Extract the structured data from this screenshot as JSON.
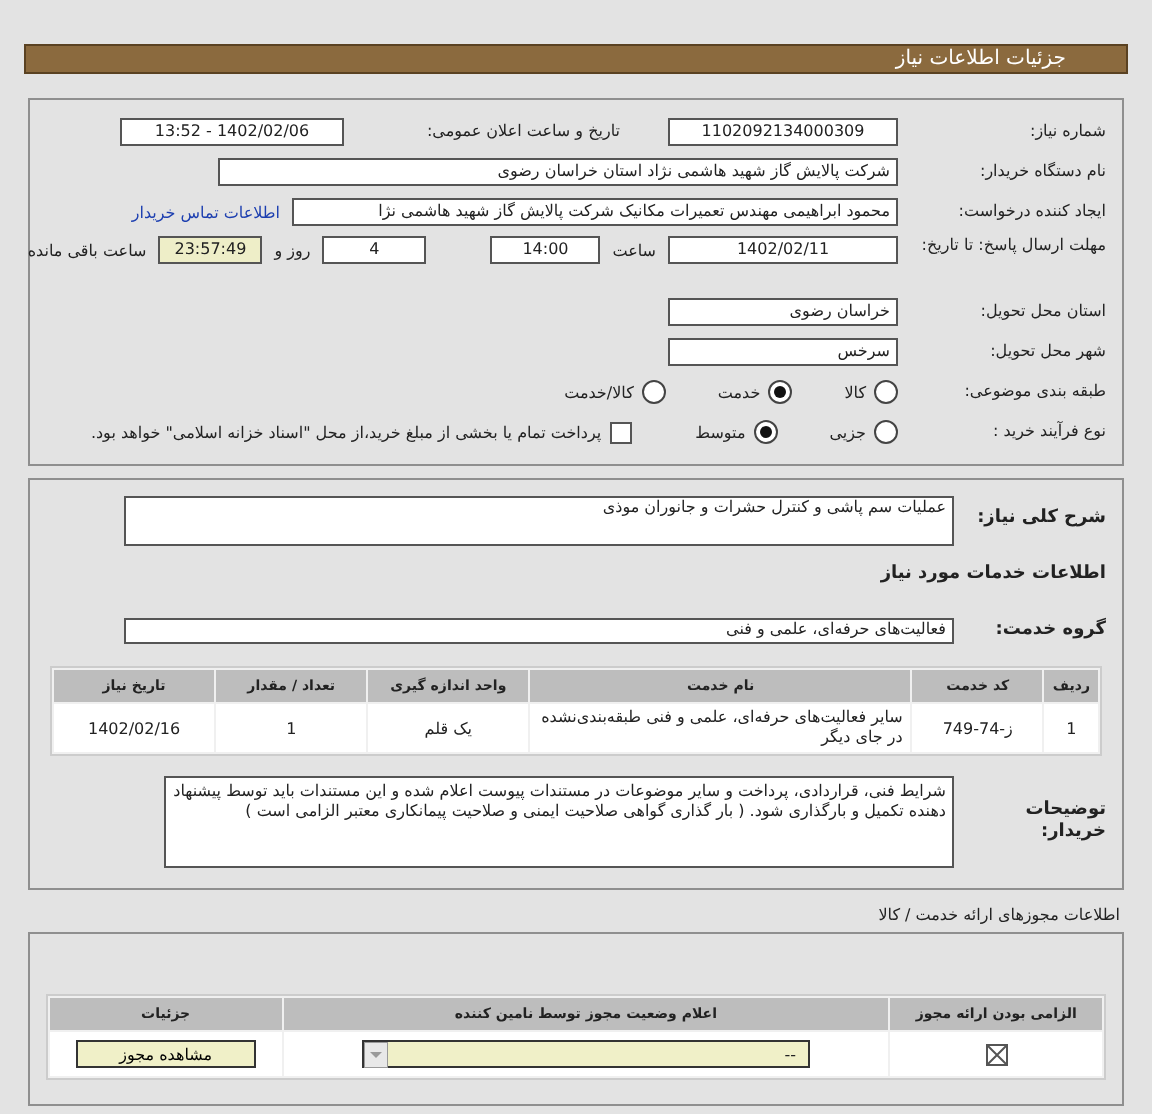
{
  "header": {
    "title": "جزئیات اطلاعات نیاز"
  },
  "details": {
    "need_number": {
      "label": "شماره نیاز:",
      "value": "1102092134000309"
    },
    "announce_date": {
      "label": "تاریخ و ساعت اعلان عمومی:",
      "value": "1402/02/06 - 13:52"
    },
    "buyer": {
      "label": "نام دستگاه خریدار:",
      "value": "شرکت پالایش گاز شهید هاشمی نژاد   استان خراسان رضوی"
    },
    "requester": {
      "label": "ایجاد کننده درخواست:",
      "value": "محمود ابراهیمی مهندس تعمیرات مکانیک شرکت پالایش گاز شهید هاشمی نژا",
      "link": "اطلاعات تماس خریدار"
    },
    "deadline": {
      "label": "مهلت ارسال پاسخ: تا تاریخ:",
      "date": "1402/02/11",
      "time_label": "ساعت",
      "time": "14:00",
      "days": "4",
      "days_label": "روز و",
      "remaining": "23:57:49",
      "remaining_label": "ساعت باقی مانده"
    },
    "province": {
      "label": "استان محل تحویل:",
      "value": "خراسان رضوی"
    },
    "city": {
      "label": "شهر محل تحویل:",
      "value": "سرخس"
    },
    "category": {
      "label": "طبقه بندی موضوعی:",
      "options": [
        {
          "label": "کالا",
          "selected": false
        },
        {
          "label": "خدمت",
          "selected": true
        },
        {
          "label": "کالا/خدمت",
          "selected": false
        }
      ]
    },
    "process": {
      "label": "نوع فرآیند خرید :",
      "options": [
        {
          "label": "جزیی",
          "selected": false
        },
        {
          "label": "متوسط",
          "selected": true
        }
      ],
      "treasury": {
        "label": "پرداخت تمام یا بخشی از مبلغ خرید،از محل \"اسناد خزانه اسلامی\" خواهد بود.",
        "checked": false
      }
    }
  },
  "need": {
    "summary": {
      "label": "شرح کلی نیاز:",
      "value": "عملیات سم پاشی و کنترل حشرات و جانوران موذی"
    },
    "services_heading": "اطلاعات خدمات مورد نیاز",
    "service_group": {
      "label": "گروه خدمت:",
      "value": "فعالیت‌های حرفه‌ای، علمی و فنی"
    },
    "table": {
      "columns": [
        "ردیف",
        "کد خدمت",
        "نام خدمت",
        "واحد اندازه گیری",
        "تعداد / مقدار",
        "تاریخ نیاز"
      ],
      "rows": [
        [
          "1",
          "ز-74-749",
          "سایر فعالیت‌های حرفه‌ای، علمی و فنی طبقه‌بندی‌نشده در جای دیگر",
          "یک قلم",
          "1",
          "1402/02/16"
        ]
      ]
    },
    "buyer_notes": {
      "label": "توضیحات خریدار:",
      "value": "شرایط فنی، قراردادی، پرداخت و سایر موضوعات در مستندات پیوست اعلام شده و این مستندات باید توسط پیشنهاد دهنده تکمیل و  بارگذاری شود. ( بار گذاری گواهی صلاحیت ایمنی و صلاحیت پیمانکاری معتبر الزامی است )"
    }
  },
  "licenses": {
    "title": "اطلاعات مجوزهای ارائه خدمت / کالا",
    "columns": [
      "الزامی بودن ارائه مجوز",
      "اعلام وضعیت مجوز توسط نامین کننده",
      "جزئیات"
    ],
    "rows": [
      {
        "required": true,
        "status": "--",
        "button": "مشاهده مجوز"
      }
    ]
  }
}
